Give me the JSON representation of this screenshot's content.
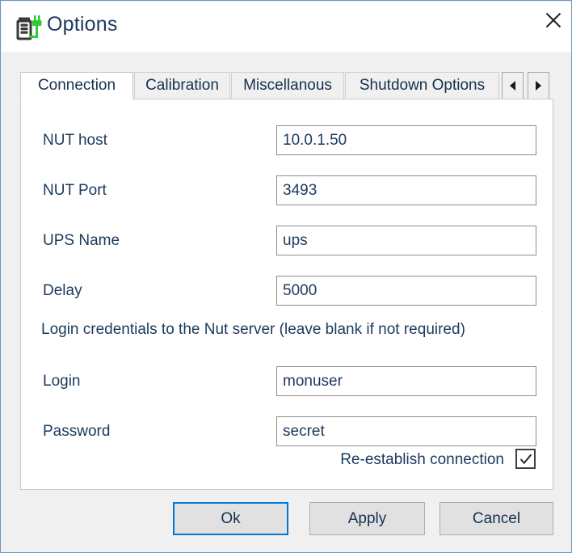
{
  "window": {
    "title": "Options",
    "icon": "battery-plug-icon",
    "close_icon": "close-icon",
    "accent_color": "#0078d7",
    "border_color": "#6d98c4",
    "text_color": "#1b3a5c",
    "chrome_color": "#f0f0f0"
  },
  "tabs": {
    "items": [
      {
        "label": "Connection",
        "active": true
      },
      {
        "label": "Calibration",
        "active": false
      },
      {
        "label": "Miscellanous",
        "active": false
      },
      {
        "label": "Shutdown Options",
        "active": false
      }
    ],
    "scroll_left_icon": "chevron-left-icon",
    "scroll_right_icon": "chevron-right-icon"
  },
  "connection": {
    "fields": [
      {
        "label": "NUT host",
        "value": "10.0.1.50",
        "placeholder": ""
      },
      {
        "label": "NUT Port",
        "value": "3493",
        "placeholder": ""
      },
      {
        "label": "UPS Name",
        "value": "ups",
        "placeholder": ""
      },
      {
        "label": "Delay",
        "value": "5000",
        "placeholder": ""
      }
    ],
    "hint": "Login credentials to the Nut server (leave blank if not required)",
    "credentials": [
      {
        "label": "Login",
        "value": "monuser",
        "placeholder": ""
      },
      {
        "label": "Password",
        "value": "secret",
        "placeholder": ""
      }
    ],
    "reestablish": {
      "label": "Re-establish connection",
      "checked": true,
      "check_icon": "checkmark-icon"
    }
  },
  "buttons": {
    "ok": "Ok",
    "apply": "Apply",
    "cancel": "Cancel"
  }
}
